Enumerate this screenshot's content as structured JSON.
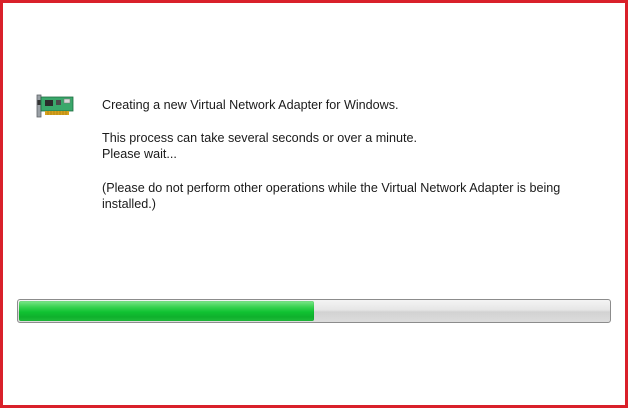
{
  "dialog": {
    "icon": "network-adapter-card-icon",
    "line1": "Creating a new Virtual Network Adapter for Windows.",
    "line2": "This process can take several seconds or over a minute.",
    "line3": "Please wait...",
    "line4": "(Please do not perform other operations while the Virtual Network Adapter is being",
    "line5": "installed.)"
  },
  "progress": {
    "fraction": 0.5,
    "fill_color": "#10c232",
    "track_color": "#e0e0e0"
  },
  "colors": {
    "frame_border": "#d9202a"
  }
}
